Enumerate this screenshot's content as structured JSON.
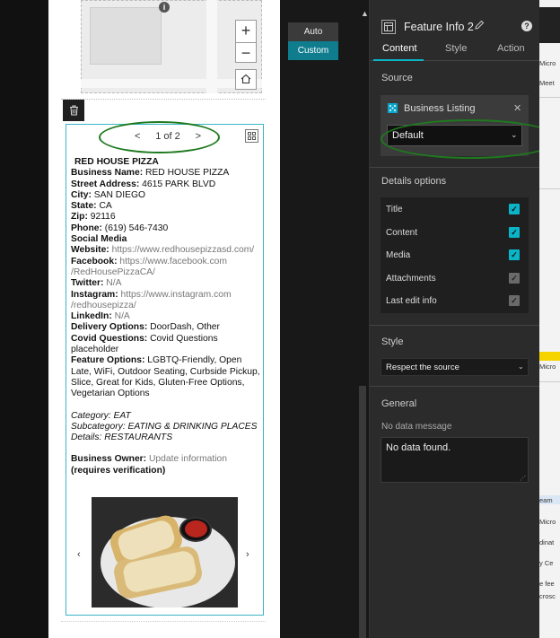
{
  "map": {
    "marker": "i",
    "zoom_in": "+",
    "zoom_out": "−",
    "home_icon": "home-icon"
  },
  "pager": {
    "prev": "<",
    "label": "1 of 2",
    "next": ">"
  },
  "feature": {
    "title": "RED HOUSE PIZZA",
    "lines": [
      {
        "label": "Business Name:",
        "value": " RED HOUSE PIZZA"
      },
      {
        "label": "Street Address:",
        "value": " 4615 PARK BLVD"
      },
      {
        "label": "City:",
        "value": " SAN DIEGO"
      },
      {
        "label": "State:",
        "value": " CA"
      },
      {
        "label": "Zip:",
        "value": " 92116"
      },
      {
        "label": "Phone:",
        "value": " (619) 546-7430"
      }
    ],
    "social_media": "Social Media",
    "website_label": "Website:",
    "website": " https://www.redhousepizzasd.com/",
    "facebook_label": "Facebook:",
    "facebook": " https://www.facebook.com /RedHousePizzaCA/",
    "twitter_label": "Twitter:",
    "twitter": " N/A",
    "instagram_label": "Instagram:",
    "instagram": " https://www.instagram.com /redhousepizza/",
    "linkedin_label": "LinkedIn:",
    "linkedin": " N/A",
    "delivery_label": "Delivery Options:",
    "delivery": " DoorDash, Other",
    "covid_label": "Covid Questions:",
    "covid": " Covid Questions placeholder",
    "feature_options_label": "Feature Options:",
    "feature_options": " LGBTQ-Friendly, Open Late, WiFi, Outdoor Seating, Curbside Pickup, Slice, Great for Kids, Gluten-Free Options, Vegetarian Options",
    "category": "Category: EAT",
    "subcategory": "Subcategory: EATING & DRINKING PLACES",
    "details": "Details: RESTAURANTS",
    "owner_label": "Business Owner:",
    "owner_value": " Update information",
    "verification": "(requires verification)",
    "carousel_prev": "‹",
    "carousel_next": "›"
  },
  "toolbar": {
    "delete_icon": "trash-icon",
    "auto": "Auto",
    "custom": "Custom",
    "collapse": "▲"
  },
  "panel": {
    "title": "Feature Info 2",
    "help": "?",
    "tabs": [
      "Content",
      "Style",
      "Action"
    ],
    "source_label": "Source",
    "data_source": "Business Listing",
    "data_view": "Default",
    "details_label": "Details options",
    "options": [
      {
        "label": "Title",
        "checked": true
      },
      {
        "label": "Content",
        "checked": true
      },
      {
        "label": "Media",
        "checked": true
      },
      {
        "label": "Attachments",
        "checked": true,
        "disabled": true
      },
      {
        "label": "Last edit info",
        "checked": true,
        "disabled": true
      }
    ],
    "style_label": "Style",
    "style_value": "Respect the source",
    "general_label": "General",
    "no_data_label": "No data message",
    "no_data_value": "No data found."
  },
  "far_window": {
    "texts": [
      "Micro",
      "Meet",
      "Micro",
      "eam",
      "Micro",
      "dinat",
      "y Ce",
      "e fee",
      "crosc"
    ]
  },
  "colors": {
    "accent": "#0ab5c8",
    "annotation_green": "#1e7a1e",
    "custom_active": "#0f7d8e"
  }
}
